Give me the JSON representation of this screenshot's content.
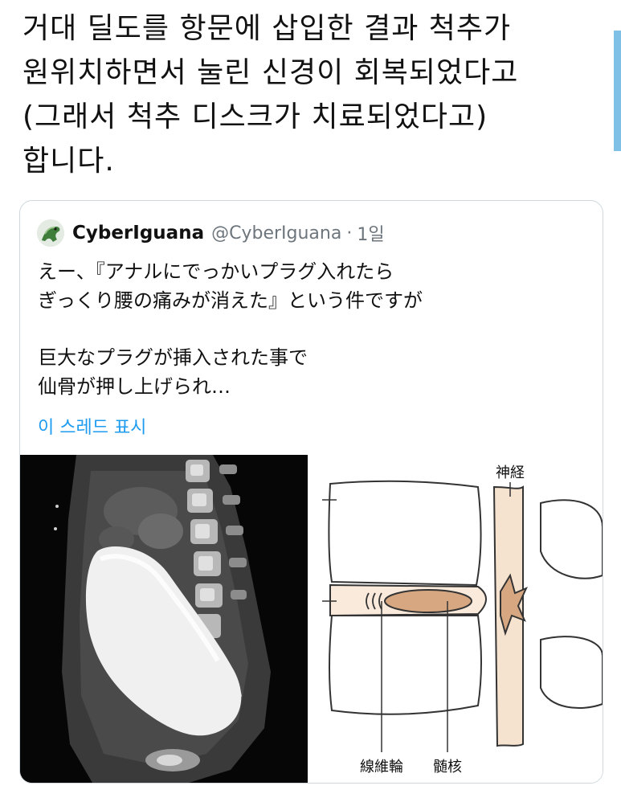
{
  "tweet": {
    "lines": [
      "거대 딜도를 항문에 삽입한 결과 척추가",
      "원위치하면서 눌린 신경이 회복되었다고",
      "(그래서 척추 디스크가 치료되었다고)",
      "합니다."
    ]
  },
  "quoted_tweet": {
    "display_name": "CyberIguana",
    "handle": "@CyberIguana",
    "separator": "·",
    "time": "1일",
    "body_lines": [
      "えー、『アナルにでっかいプラグ入れたら",
      "ぎっくり腰の痛みが消えた』という件ですが",
      "",
      "巨大なプラグが挿入された事で",
      "仙骨が押し上げられ…"
    ],
    "show_thread": "이 스레드 표시"
  },
  "diagram": {
    "nerve_label": "神経",
    "annulus_label": "線維輪",
    "nucleus_label": "髄核"
  },
  "colors": {
    "link": "#1d9bf0",
    "nucleus_fill": "#d6a780",
    "disc_fill": "#faeadb",
    "nerve_fill": "#f5e2cf"
  }
}
